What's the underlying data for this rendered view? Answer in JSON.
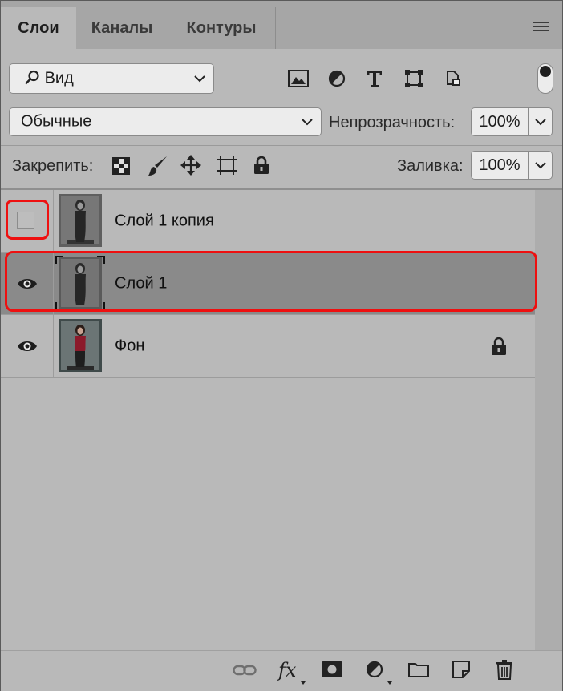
{
  "tabs": [
    {
      "label": "Слои",
      "active": true
    },
    {
      "label": "Каналы",
      "active": false
    },
    {
      "label": "Контуры",
      "active": false
    }
  ],
  "filter": {
    "label": "Вид"
  },
  "blend_mode": {
    "value": "Обычные"
  },
  "opacity": {
    "label": "Непрозрачность:",
    "value": "100%"
  },
  "lock": {
    "label": "Закрепить:"
  },
  "fill": {
    "label": "Заливка:",
    "value": "100%"
  },
  "layers": [
    {
      "name": "Слой 1 копия",
      "visible": false,
      "selected": false,
      "locked": false,
      "thumb": "grayscale"
    },
    {
      "name": "Слой 1",
      "visible": true,
      "selected": true,
      "locked": false,
      "thumb": "grayscale"
    },
    {
      "name": "Фон",
      "visible": true,
      "selected": false,
      "locked": true,
      "thumb": "color"
    }
  ],
  "colors": {
    "highlight": "#ee1010",
    "panel": "#b9b9b9",
    "selected_row": "#8a8a8a"
  },
  "bottom_tools": [
    "link-icon",
    "fx-icon",
    "mask-icon",
    "adjustment-icon",
    "folder-icon",
    "new-layer-icon",
    "trash-icon"
  ],
  "fx_text": "fx"
}
